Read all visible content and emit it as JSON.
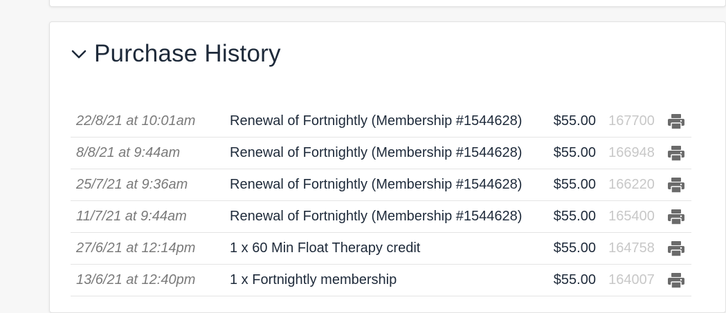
{
  "section": {
    "title": "Purchase History",
    "collapse_icon": "chevron-down-icon"
  },
  "colors": {
    "title": "#1e2a3a",
    "date_text": "#7a7a7a",
    "order_id_text": "#c8c8c8",
    "printer_icon": "#6b6b6b"
  },
  "purchases": [
    {
      "date": "22/8/21 at 10:01am",
      "description": "Renewal of Fortnightly (Membership #1544628)",
      "amount": "$55.00",
      "order_id": "167700",
      "icon": "printer-icon"
    },
    {
      "date": "8/8/21 at 9:44am",
      "description": "Renewal of Fortnightly (Membership #1544628)",
      "amount": "$55.00",
      "order_id": "166948",
      "icon": "printer-icon"
    },
    {
      "date": "25/7/21 at 9:36am",
      "description": "Renewal of Fortnightly (Membership #1544628)",
      "amount": "$55.00",
      "order_id": "166220",
      "icon": "printer-icon"
    },
    {
      "date": "11/7/21 at 9:44am",
      "description": "Renewal of Fortnightly (Membership #1544628)",
      "amount": "$55.00",
      "order_id": "165400",
      "icon": "printer-icon"
    },
    {
      "date": "27/6/21 at 12:14pm",
      "description": "1 x 60 Min Float Therapy credit",
      "amount": "$55.00",
      "order_id": "164758",
      "icon": "printer-icon"
    },
    {
      "date": "13/6/21 at 12:40pm",
      "description": "1 x Fortnightly membership",
      "amount": "$55.00",
      "order_id": "164007",
      "icon": "printer-icon"
    }
  ]
}
